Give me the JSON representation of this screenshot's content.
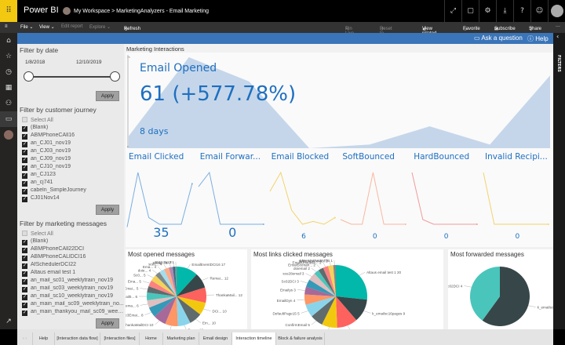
{
  "app": {
    "name": "Power BI",
    "breadcrumb_workspace": "My Workspace",
    "breadcrumb_sep": ">",
    "breadcrumb_report": "MarketingAnalyzers - Email Marketing"
  },
  "toolbar": {
    "file": "File ⌄",
    "view": "View ⌄",
    "edit": "Edit report",
    "explore": "Explore ⌄",
    "refresh": "Refresh",
    "pin": "Pin Live Page",
    "reset": "Reset to default",
    "view_related": "View related",
    "favorite": "Favorite",
    "subscribe": "Subscribe",
    "share": "Share",
    "more": "···"
  },
  "bluebar": {
    "ask": "Ask a question",
    "help": "Help"
  },
  "filters_strip": "FILTERS",
  "filter_date": {
    "title": "Filter by date",
    "start": "1/8/2018",
    "end": "12/10/2019",
    "apply": "Apply"
  },
  "filter_journey": {
    "title": "Filter by customer journey",
    "select_all": "Select All",
    "items": [
      "(Blank)",
      "ABMPhoneCAll16",
      "an_CJ01_nov19",
      "an_CJ03_nov19",
      "an_CJ09_nov19",
      "an_CJ10_nov19",
      "an_CJ123",
      "an_cj741",
      "cabeln_SimpleJourney",
      "CJ01Nov14"
    ],
    "apply": "Apply"
  },
  "filter_messages": {
    "title": "Filter by marketing messages",
    "select_all": "Select All",
    "items": [
      "(Blank)",
      "ABMPhoneCAll22DCI",
      "ABMPhoneCALlDCI16",
      "AfSchedulerDCI22",
      "Altaus email test 1",
      "an_mail_sc01_weeklytrain_nov19",
      "an_mail_sc03_weeklytrain_nov19",
      "an_mail_sc10_weeklytrain_nov19",
      "an_main_mail_sc09_weeklytrain_no...",
      "an_main_thankyou_mail_sc09_week..."
    ],
    "apply": "Apply"
  },
  "interactions": {
    "title": "Marketing Interactions",
    "kpi_label": "Email Opened",
    "kpi_value": "61 (+577.78%)",
    "kpi_period": "8 days",
    "axis_max": "75",
    "axis_min": "0",
    "trend": [
      10,
      75,
      55,
      0,
      3,
      18,
      3,
      60
    ],
    "color": "#c5d6ea"
  },
  "sparklines": [
    {
      "title": "Email Clicked",
      "value": "35",
      "trend": [
        2,
        60,
        12,
        5,
        5,
        5,
        48
      ],
      "color": "#7aaee0"
    },
    {
      "title": "Email Forwar...",
      "value": "0",
      "trend": [
        45,
        60,
        5,
        5,
        5,
        5,
        5
      ],
      "color": "#7aaee0"
    },
    {
      "title": "Email Blocked",
      "value": "6",
      "trend": [
        40,
        60,
        20,
        5,
        8,
        5,
        12
      ],
      "color": "#f2d36b"
    },
    {
      "title": "SoftBounced",
      "value": "0",
      "trend": [
        10,
        5,
        5,
        60,
        5,
        5,
        5
      ],
      "color": "#f8b8a0"
    },
    {
      "title": "HardBounced",
      "value": "0",
      "trend": [
        60,
        10,
        5,
        5,
        5,
        5,
        5
      ],
      "color": "#f29a9a"
    },
    {
      "title": "Invalid Recipi...",
      "value": "0",
      "trend": [
        60,
        5,
        5,
        5,
        5,
        5,
        5
      ],
      "color": "#f2d36b"
    }
  ],
  "pies": [
    {
      "title": "Most opened messages",
      "slices": [
        {
          "label": "EmailEventDCI16",
          "value": 17
        },
        {
          "label": "Remai...",
          "value": 12
        },
        {
          "label": "ThankaMail...",
          "value": 12
        },
        {
          "label": "DCI...",
          "value": 10
        },
        {
          "label": "Em...",
          "value": 10
        },
        {
          "label": "Ema...",
          "value": 10
        },
        {
          "label": "Ema...",
          "value": 10
        },
        {
          "label": "ThankaMailDCI",
          "value": 10
        },
        {
          "label": "Sc3Emai...",
          "value": 8
        },
        {
          "label": "Altaus ema...",
          "value": 6
        },
        {
          "label": "Email0...",
          "value": 6
        },
        {
          "label": "Emai...",
          "value": 5
        },
        {
          "label": "Ema...",
          "value": 5
        },
        {
          "label": "Sc0...",
          "value": 5
        },
        {
          "label": "doie...",
          "value": 4
        },
        {
          "label": "Ema...",
          "value": 4
        },
        {
          "label": "sce1...",
          "value": 4
        },
        {
          "label": "Email...",
          "value": 3
        },
        {
          "label": "EMAIL...",
          "value": 2
        },
        {
          "label": "N12",
          "value": 1
        }
      ]
    },
    {
      "title": "Most links clicked messages",
      "slices": [
        {
          "label": "Altaus email test 1",
          "value": 20
        },
        {
          "label": "k_emailsc16pages",
          "value": 9
        },
        {
          "label": "Consent21Nov",
          "value": 8
        },
        {
          "label": "Sc24Nov",
          "value": 6
        },
        {
          "label": "ConfirmEmail",
          "value": 5
        },
        {
          "label": "DefaultPage15",
          "value": 5
        },
        {
          "label": "EmailDyn",
          "value": 4
        },
        {
          "label": "Emailys",
          "value": 3
        },
        {
          "label": "Sc02DCI",
          "value": 3
        },
        {
          "label": "sce28email",
          "value": 3
        },
        {
          "label": "doiemail",
          "value": 2
        },
        {
          "label": "EmailScenari...",
          "value": 2
        },
        {
          "label": "EmailUnsubsc...",
          "value": 2
        },
        {
          "label": "subscribeconfi...",
          "value": 2
        },
        {
          "label": "EMAILNOV15MTB",
          "value": 1
        }
      ]
    },
    {
      "title": "Most forwarded messages",
      "slices": [
        {
          "label": "k_emailsc16pa...",
          "value": 6
        },
        {
          "label": "Sc02DCI",
          "value": 4
        }
      ]
    }
  ],
  "tabs": [
    "Help",
    "[Interaction data flow]",
    "[Interaction files]",
    "Home",
    "Marketing plan",
    "Email design",
    "Interaction timeline",
    "Block & failure analysis"
  ],
  "active_tab": "Interaction timeline",
  "palette": [
    "#01b8aa",
    "#374649",
    "#fd625e",
    "#f2c80f",
    "#5f6b6d",
    "#8ad4eb",
    "#fe9666",
    "#a66999",
    "#3599b8",
    "#dfbfbf",
    "#4ac5bb",
    "#5f6b6d",
    "#fb8281",
    "#f4d25a",
    "#7f898a",
    "#a4ddee",
    "#fdab89",
    "#b687ac",
    "#28738a",
    "#a78f8f"
  ]
}
